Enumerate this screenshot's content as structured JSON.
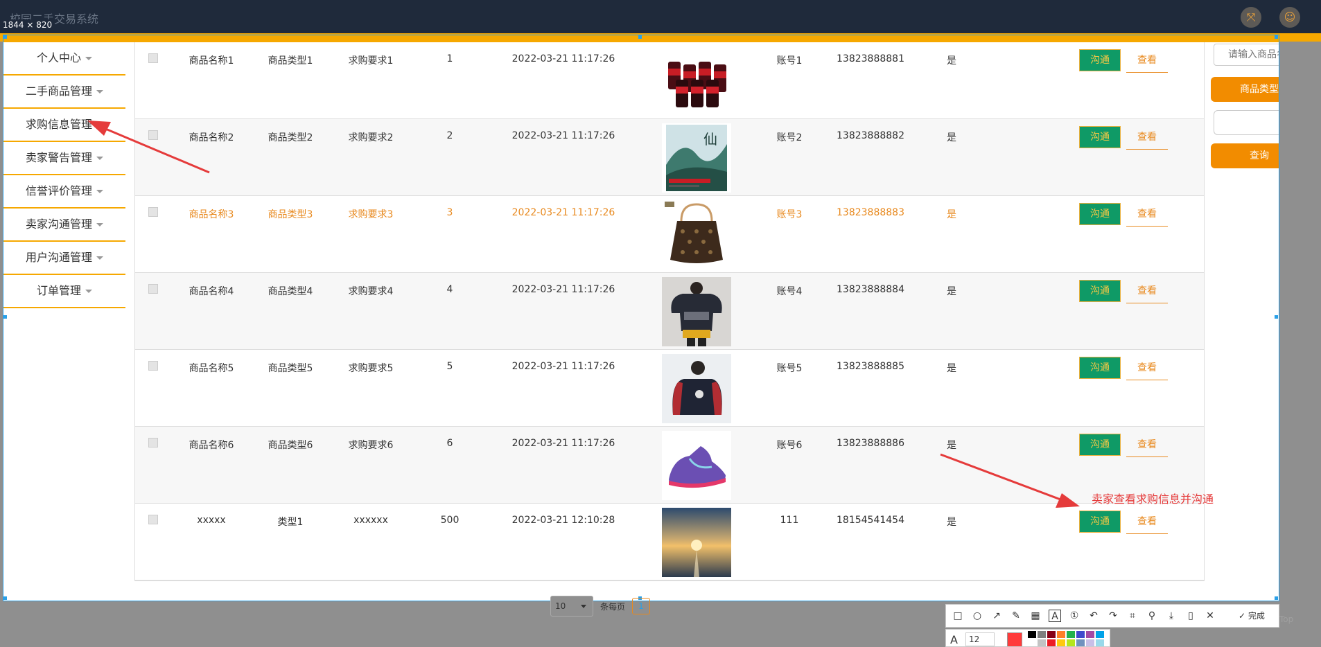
{
  "app": {
    "title": "校园二手交易系统",
    "size_label": "1844 × 820"
  },
  "sidebar": {
    "items": [
      {
        "label": "个人中心"
      },
      {
        "label": "二手商品管理"
      },
      {
        "label": "求购信息管理"
      },
      {
        "label": "卖家警告管理"
      },
      {
        "label": "信誉评价管理"
      },
      {
        "label": "卖家沟通管理"
      },
      {
        "label": "用户沟通管理"
      },
      {
        "label": "订单管理"
      }
    ]
  },
  "table": {
    "comm_label": "沟通",
    "view_label": "查看",
    "rows": [
      {
        "name": "商品名称1",
        "type": "商品类型1",
        "req": "求购要求1",
        "qty": "1",
        "time": "2022-03-21 11:17:26",
        "account": "账号1",
        "phone": "13823888881",
        "flag": "是",
        "image": "cans"
      },
      {
        "name": "商品名称2",
        "type": "商品类型2",
        "req": "求购要求2",
        "qty": "2",
        "time": "2022-03-21 11:17:26",
        "account": "账号2",
        "phone": "13823888882",
        "flag": "是",
        "image": "book"
      },
      {
        "name": "商品名称3",
        "type": "商品类型3",
        "req": "求购要求3",
        "qty": "3",
        "time": "2022-03-21 11:17:26",
        "account": "账号3",
        "phone": "13823888883",
        "flag": "是",
        "image": "bag"
      },
      {
        "name": "商品名称4",
        "type": "商品类型4",
        "req": "求购要求4",
        "qty": "4",
        "time": "2022-03-21 11:17:26",
        "account": "账号4",
        "phone": "13823888884",
        "flag": "是",
        "image": "hoodie"
      },
      {
        "name": "商品名称5",
        "type": "商品类型5",
        "req": "求购要求5",
        "qty": "5",
        "time": "2022-03-21 11:17:26",
        "account": "账号5",
        "phone": "13823888885",
        "flag": "是",
        "image": "sweater"
      },
      {
        "name": "商品名称6",
        "type": "商品类型6",
        "req": "求购要求6",
        "qty": "6",
        "time": "2022-03-21 11:17:26",
        "account": "账号6",
        "phone": "13823888886",
        "flag": "是",
        "image": "sneaker"
      },
      {
        "name": "xxxxx",
        "type": "类型1",
        "req": "xxxxxx",
        "qty": "500",
        "time": "2022-03-21 12:10:28",
        "account": "111",
        "phone": "18154541454",
        "flag": "是",
        "image": "sunset"
      }
    ]
  },
  "search": {
    "placeholder": "请输入商品名称",
    "type_label": "商品类型",
    "query_label": "查询"
  },
  "annotation": {
    "text": "卖家查看求购信息并沟通"
  },
  "pagination": {
    "page_size": "10",
    "per_page_label": "条每页",
    "current_page": "1"
  },
  "ghost_text": "Top",
  "screenshot_toolbar": {
    "tools": [
      "rect-icon",
      "circle-icon",
      "arrow-icon",
      "pen-icon",
      "mosaic-icon",
      "text-icon",
      "number-icon",
      "undo-icon",
      "redo-icon",
      "ocr-icon",
      "pin-icon",
      "save-icon",
      "copy-icon",
      "cancel-icon"
    ],
    "done_label": "完成",
    "font_size": "12",
    "current_color": "#ff3b3b",
    "swatches": [
      "#000000",
      "#7f7f7f",
      "#880015",
      "#ff7f27",
      "#22b14c",
      "#3f48cc",
      "#a349a4",
      "#00a2e8",
      "#ffffff",
      "#c3c3c3",
      "#ed1c24",
      "#ffc90e",
      "#b5e61d",
      "#7092be",
      "#c8bfe7",
      "#99d9ea"
    ]
  },
  "colors": {
    "accent": "#f6a800",
    "comm_btn": "#0f9a66",
    "highlight_row": "#e8891e",
    "annotation": "#e53b3b"
  }
}
